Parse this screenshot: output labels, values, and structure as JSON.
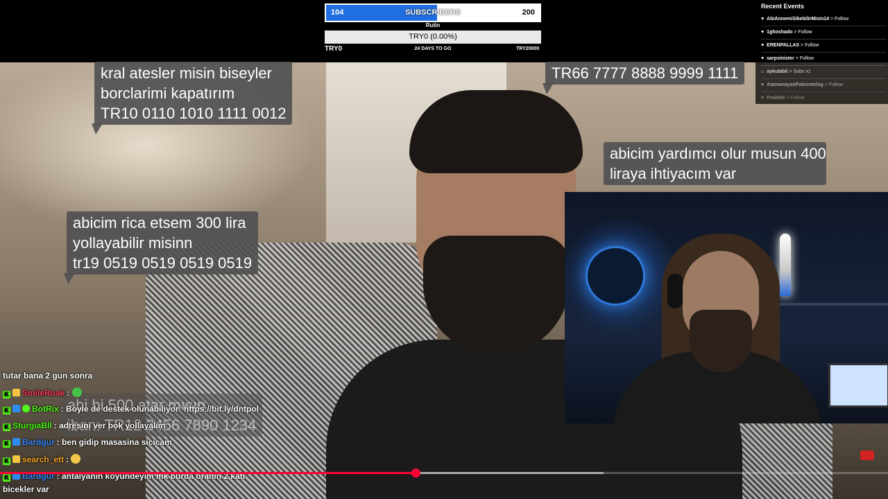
{
  "goal": {
    "current": "104",
    "label": "SUBSCRIBERS",
    "target": "200",
    "fraction": 0.52,
    "fill_color": "#1f6fe0"
  },
  "tip_goal": {
    "donor": "Rutin",
    "status": "TRY0 (0.00%)",
    "low": "TRY0",
    "days": "24 DAYS TO GO",
    "high": "TRY20000"
  },
  "recent_events": {
    "title": "Recent Events",
    "items": [
      {
        "user": "AbiAnnemiSikebilirMisin14",
        "action": "> Follow"
      },
      {
        "user": "1ghoshado",
        "action": "> Follow"
      },
      {
        "user": "ERENPALLAS",
        "action": "> Follow"
      },
      {
        "user": "sarpsinister",
        "action": "> Follow"
      },
      {
        "user": "aykutabii",
        "action": "> Subs x1"
      },
      {
        "user": "AtanamayanPaleontolog",
        "action": "> Follow"
      },
      {
        "user": "Peakble",
        "action": "> Follow"
      }
    ]
  },
  "speech_bubbles": {
    "b1": [
      "kral atesler misin biseyler",
      "borclarimi kapatırım",
      "TR10 0110 1010 1111 0012"
    ],
    "b2": [
      "TR66 7777 8888 9999 1111"
    ],
    "b3": [
      "abicim yardımcı olur musun 400",
      "liraya ihtiyacım var"
    ],
    "b4": [
      "abicim rica etsem 300 lira",
      "yollayabilir misinn",
      "tr19 0519 0519 0519 0519"
    ],
    "b5": [
      "abi bi 500 atar mısın",
      "iban: TR12 3456 7890 1234"
    ]
  },
  "chat": {
    "cont": "tutar bana 2 gun sonra",
    "messages": [
      {
        "user": "SmileRoak",
        "color": "#ff3b5c",
        "text": ":"
      },
      {
        "user": "BotRix",
        "color": "#53fc18",
        "text": ": Boyle de destek olunabiliyor: https://bit.ly/dntpol"
      },
      {
        "user": "SturgiaBll",
        "color": "#53fc18",
        "text": ": adresini ver bok yollayalım"
      },
      {
        "user": "Bardgur",
        "color": "#3a8bff",
        "text": ": ben gidip masasina sicicam"
      },
      {
        "user": "search_ett",
        "color": "#f5a623",
        "text": ":"
      },
      {
        "user": "Bardgur",
        "color": "#3a8bff",
        "text": ": antalyanin koyundeyim mk burda oranin 2 kati"
      }
    ],
    "last_cont": "bicekler var"
  },
  "video": {
    "progress": 0.468,
    "buffered": 0.68,
    "accent": "#ff0033"
  }
}
